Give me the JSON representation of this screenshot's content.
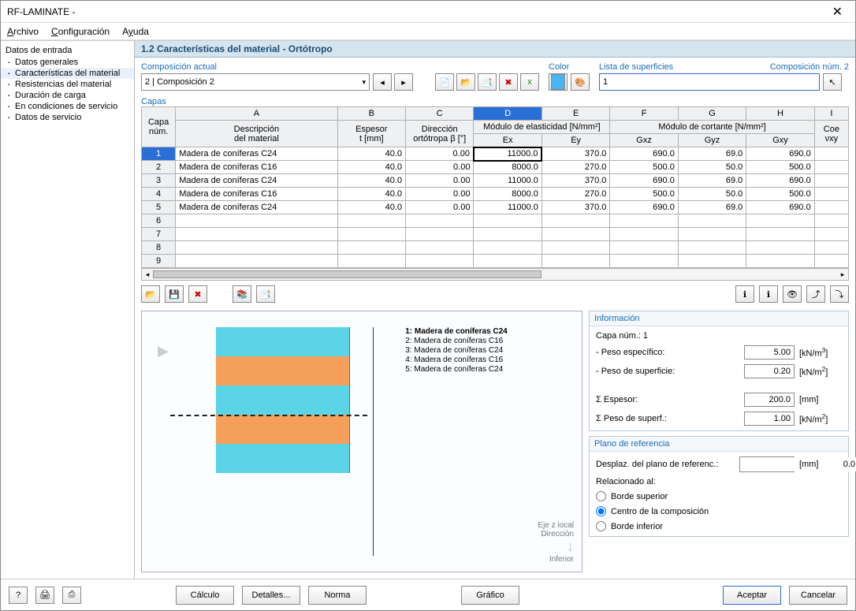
{
  "window_title": "RF-LAMINATE -",
  "menu": {
    "archivo": "Archivo",
    "config": "Configuración",
    "ayuda": "Ayuda"
  },
  "sidebar": {
    "root": "Datos de entrada",
    "items": [
      "Datos generales",
      "Características del material",
      "Resistencias del material",
      "Duración de carga",
      "En condiciones de servicio",
      "Datos de servicio"
    ]
  },
  "section": "1.2 Características del material - Ortótropo",
  "compo": {
    "label": "Composición actual",
    "value": "2 | Composición 2"
  },
  "color_label": "Color",
  "surf": {
    "label": "Lista de superficies",
    "right": "Composición núm. 2",
    "value": "1"
  },
  "capas_label": "Capas",
  "cols": {
    "A": "A",
    "B": "B",
    "C": "C",
    "D": "D",
    "E": "E",
    "F": "F",
    "G": "G",
    "H": "H",
    "I": "I"
  },
  "head": {
    "capa": "Capa",
    "num": "núm.",
    "desc1": "Descripción",
    "desc2": "del material",
    "esp1": "Espesor",
    "esp2": "t [mm]",
    "dir1": "Dirección",
    "dir2": "ortótropa β [°]",
    "me_group": "Módulo de elasticidad [N/mm²]",
    "ex": "Ex",
    "ey": "Ey",
    "mc_group": "Módulo de cortante [N/mm²]",
    "gxz": "Gxz",
    "gyz": "Gyz",
    "gxy": "Gxy",
    "coef": "Coe",
    "vxy": "νxy"
  },
  "rows": [
    {
      "n": "1",
      "desc": "Madera de coníferas C24",
      "t": "40.0",
      "b": "0.00",
      "ex": "11000.0",
      "ey": "370.0",
      "gxz": "690.0",
      "gyz": "69.0",
      "gxy": "690.0"
    },
    {
      "n": "2",
      "desc": "Madera de coníferas C16",
      "t": "40.0",
      "b": "0.00",
      "ex": "8000.0",
      "ey": "270.0",
      "gxz": "500.0",
      "gyz": "50.0",
      "gxy": "500.0"
    },
    {
      "n": "3",
      "desc": "Madera de coníferas C24",
      "t": "40.0",
      "b": "0.00",
      "ex": "11000.0",
      "ey": "370.0",
      "gxz": "690.0",
      "gyz": "69.0",
      "gxy": "690.0"
    },
    {
      "n": "4",
      "desc": "Madera de coníferas C16",
      "t": "40.0",
      "b": "0.00",
      "ex": "8000.0",
      "ey": "270.0",
      "gxz": "500.0",
      "gyz": "50.0",
      "gxy": "500.0"
    },
    {
      "n": "5",
      "desc": "Madera de coníferas C24",
      "t": "40.0",
      "b": "0.00",
      "ex": "11000.0",
      "ey": "370.0",
      "gxz": "690.0",
      "gyz": "69.0",
      "gxy": "690.0"
    }
  ],
  "empty_rows": [
    "6",
    "7",
    "8",
    "9"
  ],
  "preview_labels": [
    "1: Madera de coníferas C24",
    "2: Madera de coníferas C16",
    "3: Madera de coníferas C24",
    "4: Madera de coníferas C16",
    "5: Madera de coníferas C24"
  ],
  "axis": {
    "l1": "Eje z local",
    "l2": "Dirección",
    "l3": "↓",
    "l4": "Inferior"
  },
  "info": {
    "title": "Información",
    "layer": "Capa núm.: 1",
    "peso_esp_k": "- Peso específico:",
    "peso_esp_v": "5.00",
    "peso_esp_u": "[kN/m³]",
    "peso_sup_k": "- Peso de superficie:",
    "peso_sup_v": "0.20",
    "peso_sup_u": "[kN/m²]",
    "sum_esp_k": "Σ Espesor:",
    "sum_esp_v": "200.0",
    "sum_esp_u": "[mm]",
    "sum_ps_k": "Σ Peso de superf.:",
    "sum_ps_v": "1.00",
    "sum_ps_u": "[kN/m²]"
  },
  "ref": {
    "title": "Plano de referencia",
    "desplaz_k": "Desplaz. del plano de referenc.:",
    "desplaz_v": "0.0",
    "desplaz_u": "[mm]",
    "rel": "Relacionado al:",
    "r1": "Borde superior",
    "r2": "Centro de la composición",
    "r3": "Borde inferior"
  },
  "footer": {
    "calc": "Cálculo",
    "det": "Detalles...",
    "norma": "Norma",
    "graf": "Gráfico",
    "ok": "Aceptar",
    "cancel": "Cancelar"
  }
}
